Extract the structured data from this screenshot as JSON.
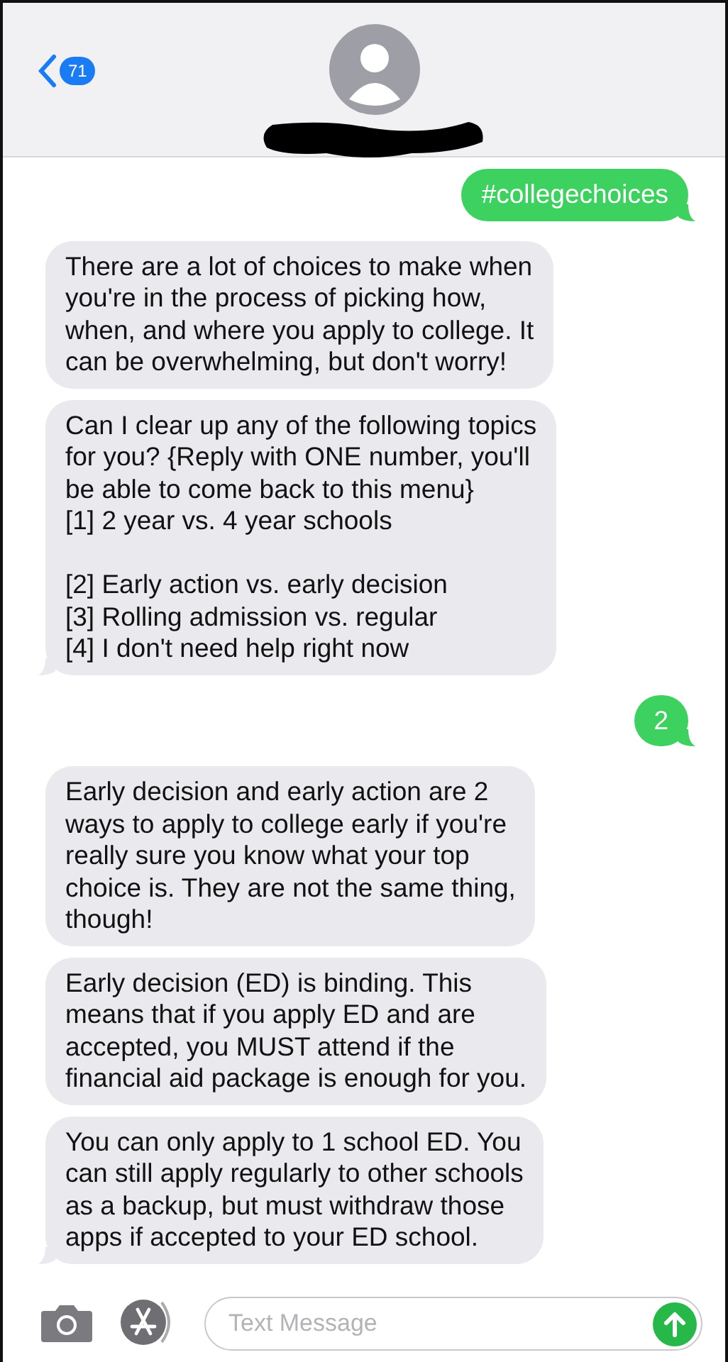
{
  "header": {
    "back_count": "71"
  },
  "messages": [
    {
      "kind": "sent",
      "text": "#collegechoices"
    },
    {
      "kind": "received",
      "text": "There are a lot of choices to make when\nyou're in the process of picking how,\nwhen, and where you apply to college. It\ncan be overwhelming, but don't worry!"
    },
    {
      "kind": "received",
      "text": "Can I clear up any of the following topics\nfor you? {Reply with ONE number, you'll\nbe able to come back to this menu}\n[1] 2 year vs. 4 year schools\n\n[2] Early action vs. early decision\n[3] Rolling admission vs. regular\n[4] I don't need help right now"
    },
    {
      "kind": "sent",
      "text": "2"
    },
    {
      "kind": "received",
      "text": "Early decision and early action are 2\nways to apply to college early if you're\nreally sure you know what your top\nchoice is. They are not the same thing,\nthough!"
    },
    {
      "kind": "received",
      "text": "Early decision (ED) is binding. This\nmeans that if you apply ED and are\naccepted, you MUST attend if the\nfinancial aid package is enough for you."
    },
    {
      "kind": "received",
      "text": "You can only apply to 1 school ED. You\ncan still apply regularly to other schools\nas a backup, but must withdraw those\napps if accepted to your ED school."
    }
  ],
  "composer": {
    "placeholder": "Text Message"
  }
}
